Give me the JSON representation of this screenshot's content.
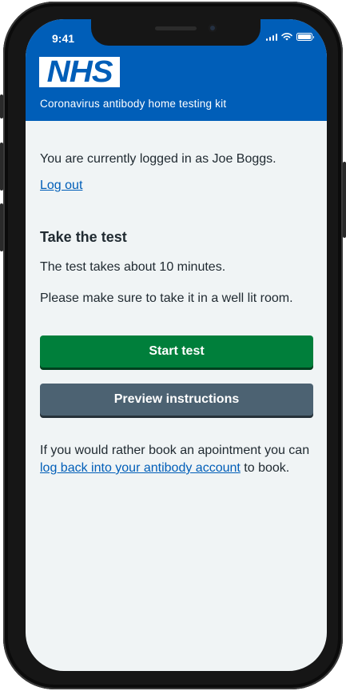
{
  "status_bar": {
    "time": "9:41"
  },
  "header": {
    "logo_text": "NHS",
    "service_name": "Coronavirus antibody home testing kit"
  },
  "content": {
    "logged_in_text": "You are currently logged in as Joe Boggs.",
    "logout_link": "Log out",
    "section_title": "Take the test",
    "duration_text": "The test takes about 10 minutes.",
    "lighting_text": "Please make sure to take it in a well lit room.",
    "start_button": "Start test",
    "preview_button": "Preview instructions",
    "rebook_text_before": "If you would rather book an apointment you can",
    "rebook_link": "log back into your antibody account",
    "rebook_text_after": " to book."
  },
  "colors": {
    "brand_blue": "#005eb8",
    "start_green": "#007f3b",
    "secondary_grey": "#4c6272",
    "background": "#f0f4f5"
  }
}
